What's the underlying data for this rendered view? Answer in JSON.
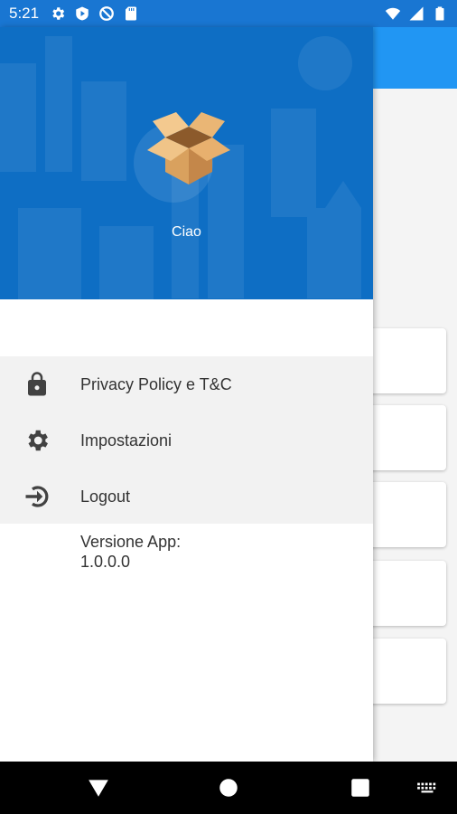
{
  "status_bar": {
    "time": "5:21",
    "left_icons": [
      "gear-icon",
      "play-icon",
      "no-sync-icon",
      "sd-card-icon"
    ],
    "right_icons": [
      "wifi-icon",
      "signal-icon",
      "battery-icon"
    ]
  },
  "drawer": {
    "header": {
      "logo": "box-icon",
      "greeting": "Ciao"
    },
    "menu": [
      {
        "icon": "lock-icon",
        "label": "Privacy Policy e T&C"
      },
      {
        "icon": "gear-icon",
        "label": "Impostazioni"
      },
      {
        "icon": "logout-icon",
        "label": "Logout"
      }
    ],
    "version_label": "Versione App:",
    "version_value": "1.0.0.0"
  },
  "nav_bar": {
    "buttons": [
      "back-icon",
      "home-icon",
      "recents-icon",
      "keyboard-icon"
    ]
  },
  "colors": {
    "status_bar": "#1976d2",
    "toolbar": "#2196f3",
    "drawer_header": "#0e6ec4",
    "menu_bg": "#f2f2f2"
  }
}
